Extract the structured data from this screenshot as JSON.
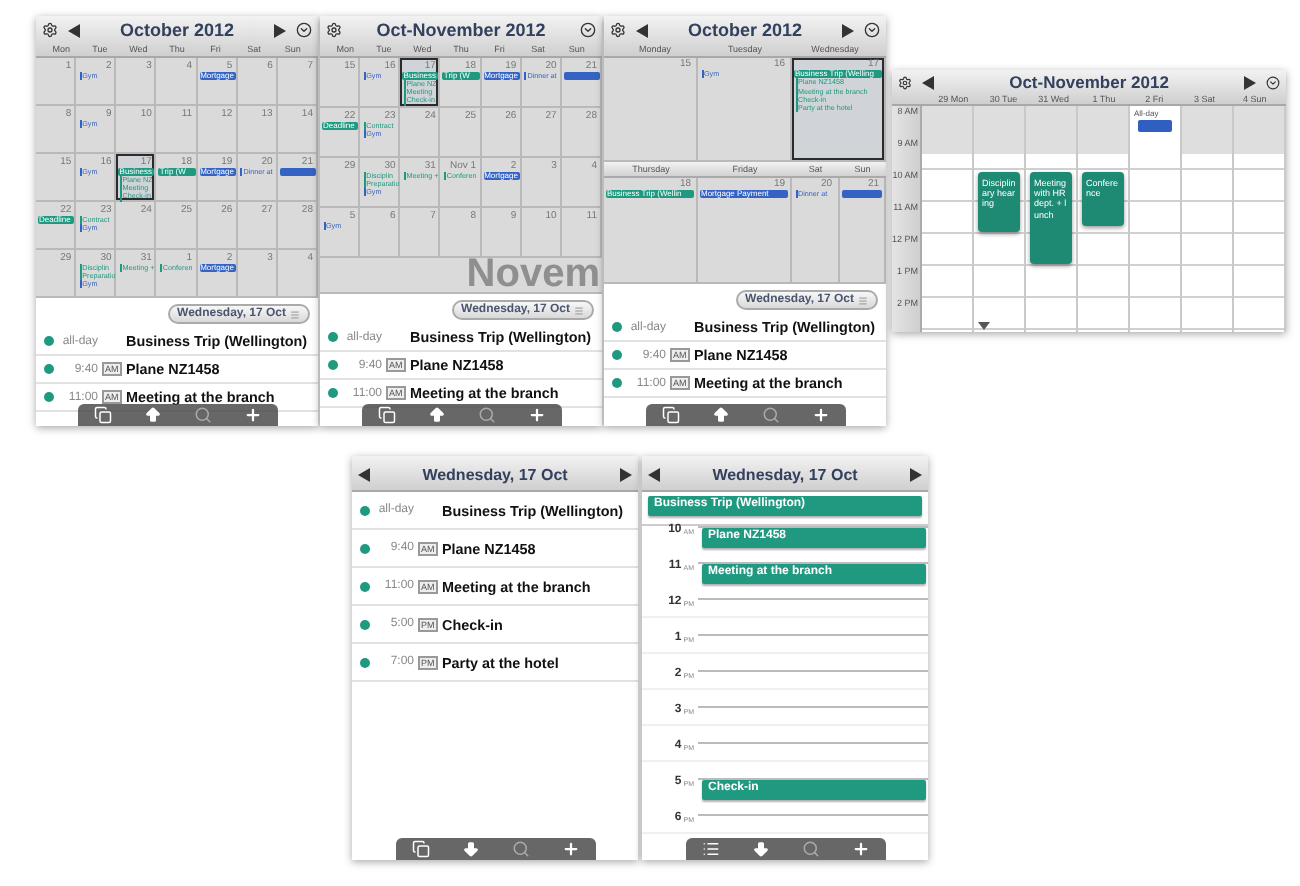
{
  "screens": [
    {
      "kind": "month",
      "title": "October 2012",
      "arrows": true,
      "weekdays": [
        "Mon",
        "Tue",
        "Wed",
        "Thu",
        "Fri",
        "Sat",
        "Sun"
      ],
      "weeks": [
        {
          "days": [
            {
              "day": "1",
              "selected": false
            },
            {
              "day": "2",
              "selected": false,
              "events": [
                {
                  "kind": "text",
                  "text": "Gym",
                  "color": "#3563c4"
                }
              ]
            },
            {
              "day": "3",
              "selected": false
            },
            {
              "day": "4",
              "selected": false
            },
            {
              "day": "5",
              "selected": false,
              "events": [
                {
                  "kind": "chip",
                  "text": "Mortgage",
                  "color": "#3563c4"
                }
              ]
            },
            {
              "day": "6",
              "selected": false
            },
            {
              "day": "7",
              "selected": false
            }
          ]
        },
        {
          "days": [
            {
              "day": "8",
              "selected": false
            },
            {
              "day": "9",
              "selected": false,
              "events": [
                {
                  "kind": "text",
                  "text": "Gym",
                  "color": "#3563c4"
                }
              ]
            },
            {
              "day": "10",
              "selected": false
            },
            {
              "day": "11",
              "selected": false
            },
            {
              "day": "12",
              "selected": false
            },
            {
              "day": "13",
              "selected": false
            },
            {
              "day": "14",
              "selected": false
            }
          ]
        },
        {
          "days": [
            {
              "day": "15",
              "selected": false
            },
            {
              "day": "16",
              "selected": false,
              "events": [
                {
                  "kind": "text",
                  "text": "Gym",
                  "color": "#3563c4"
                }
              ]
            },
            {
              "day": "17",
              "selected": true,
              "events": [
                {
                  "kind": "chip",
                  "text": "Business",
                  "color": "#1f9a80"
                },
                {
                  "kind": "text",
                  "text": "Plane NZ",
                  "color": "#1f9a80"
                },
                {
                  "kind": "text",
                  "text": "Meeting",
                  "color": "#1f9a80"
                },
                {
                  "kind": "text",
                  "text": "Check-in",
                  "color": "#1f9a80"
                }
              ]
            },
            {
              "day": "18",
              "selected": false,
              "events": [
                {
                  "kind": "chip",
                  "text": "Trip (W",
                  "color": "#1f9a80"
                }
              ]
            },
            {
              "day": "19",
              "selected": false,
              "events": [
                {
                  "kind": "chip",
                  "text": "Mortgage",
                  "color": "#3563c4"
                }
              ]
            },
            {
              "day": "20",
              "selected": false,
              "events": [
                {
                  "kind": "text",
                  "text": "Dinner at",
                  "color": "#3563c4"
                }
              ]
            },
            {
              "day": "21",
              "selected": false,
              "events": [
                {
                  "kind": "chip",
                  "color": "#3563c4"
                }
              ]
            }
          ]
        },
        {
          "days": [
            {
              "day": "22",
              "selected": false,
              "events": [
                {
                  "kind": "chip",
                  "text": "Deadline",
                  "color": "#1f9a80"
                }
              ]
            },
            {
              "day": "23",
              "selected": false,
              "events": [
                {
                  "kind": "text",
                  "text": "Contract",
                  "color": "#1f9a80"
                },
                {
                  "kind": "text",
                  "text": "Gym",
                  "color": "#3563c4"
                }
              ]
            },
            {
              "day": "24",
              "selected": false
            },
            {
              "day": "25",
              "selected": false
            },
            {
              "day": "26",
              "selected": false
            },
            {
              "day": "27",
              "selected": false
            },
            {
              "day": "28",
              "selected": false
            }
          ]
        },
        {
          "days": [
            {
              "day": "29",
              "selected": false
            },
            {
              "day": "30",
              "selected": false,
              "events": [
                {
                  "kind": "text",
                  "text": "Disciplin",
                  "color": "#1f9a80"
                },
                {
                  "kind": "text",
                  "text": "Preparatio",
                  "color": "#1f9a80"
                },
                {
                  "kind": "text",
                  "text": "Gym",
                  "color": "#3563c4"
                }
              ]
            },
            {
              "day": "31",
              "selected": false,
              "events": [
                {
                  "kind": "text",
                  "text": "Meeting +",
                  "color": "#1f9a80"
                }
              ]
            },
            {
              "day": "1",
              "selected": false,
              "events": [
                {
                  "kind": "text",
                  "text": "Conferen",
                  "color": "#1f9a80"
                }
              ]
            },
            {
              "day": "2",
              "selected": false,
              "events": [
                {
                  "kind": "chip",
                  "text": "Mortgage",
                  "color": "#3563c4"
                }
              ]
            },
            {
              "day": "3",
              "selected": false
            },
            {
              "day": "4",
              "selected": false
            }
          ]
        }
      ],
      "day_pill": "Wednesday, 17 Oct",
      "agenda": [
        {
          "time": "all-day",
          "title": "Business Trip (Wellington)",
          "color": "#1f9a80"
        },
        {
          "time": "9:40",
          "badge": "AM",
          "title": "Plane NZ1458",
          "color": "#1f9a80"
        },
        {
          "time": "11:00",
          "badge": "AM",
          "title": "Meeting at the branch",
          "color": "#1f9a80"
        }
      ],
      "toolbar": [
        {
          "kind": "pages"
        },
        {
          "kind": "up"
        },
        {
          "kind": "search"
        },
        {
          "kind": "add"
        }
      ]
    },
    {
      "kind": "month",
      "title": "Oct-November 2012",
      "arrows": false,
      "weekdays": [
        "Mon",
        "Tue",
        "Wed",
        "Thu",
        "Fri",
        "Sat",
        "Sun"
      ],
      "overlay": "Novem",
      "weeks": [
        {
          "days": [
            {
              "day": "15",
              "selected": false
            },
            {
              "day": "16",
              "selected": false,
              "events": [
                {
                  "kind": "text",
                  "text": "Gym",
                  "color": "#3563c4"
                }
              ]
            },
            {
              "day": "17",
              "selected": true,
              "events": [
                {
                  "kind": "chip",
                  "text": "Business",
                  "color": "#1f9a80"
                },
                {
                  "kind": "text",
                  "text": "Plane NZ",
                  "color": "#1f9a80"
                },
                {
                  "kind": "text",
                  "text": "Meeting",
                  "color": "#1f9a80"
                },
                {
                  "kind": "text",
                  "text": "Check-in",
                  "color": "#1f9a80"
                }
              ]
            },
            {
              "day": "18",
              "selected": false,
              "events": [
                {
                  "kind": "chip",
                  "text": "Trip (W",
                  "color": "#1f9a80"
                }
              ]
            },
            {
              "day": "19",
              "selected": false,
              "events": [
                {
                  "kind": "chip",
                  "text": "Mortgage",
                  "color": "#3563c4"
                }
              ]
            },
            {
              "day": "20",
              "selected": false,
              "events": [
                {
                  "kind": "text",
                  "text": "Dinner at",
                  "color": "#3563c4"
                }
              ]
            },
            {
              "day": "21",
              "selected": false,
              "events": [
                {
                  "kind": "chip",
                  "color": "#3563c4"
                }
              ]
            }
          ]
        },
        {
          "days": [
            {
              "day": "22",
              "selected": false,
              "events": [
                {
                  "kind": "chip",
                  "text": "Deadline",
                  "color": "#1f9a80"
                }
              ]
            },
            {
              "day": "23",
              "selected": false,
              "events": [
                {
                  "kind": "text",
                  "text": "Contract",
                  "color": "#1f9a80"
                },
                {
                  "kind": "text",
                  "text": "Gym",
                  "color": "#3563c4"
                }
              ]
            },
            {
              "day": "24",
              "selected": false
            },
            {
              "day": "25",
              "selected": false
            },
            {
              "day": "26",
              "selected": false
            },
            {
              "day": "27",
              "selected": false
            },
            {
              "day": "28",
              "selected": false
            }
          ]
        },
        {
          "days": [
            {
              "day": "29",
              "selected": false
            },
            {
              "day": "30",
              "selected": false,
              "events": [
                {
                  "kind": "text",
                  "text": "Disciplin",
                  "color": "#1f9a80"
                },
                {
                  "kind": "text",
                  "text": "Preparatio",
                  "color": "#1f9a80"
                },
                {
                  "kind": "text",
                  "text": "Gym",
                  "color": "#3563c4"
                }
              ]
            },
            {
              "day": "31",
              "selected": false,
              "events": [
                {
                  "kind": "text",
                  "text": "Meeting +",
                  "color": "#1f9a80"
                }
              ]
            },
            {
              "day": "Nov 1",
              "selected": false,
              "events": [
                {
                  "kind": "text",
                  "text": "Conferen",
                  "color": "#1f9a80"
                }
              ]
            },
            {
              "day": "2",
              "selected": false,
              "events": [
                {
                  "kind": "chip",
                  "text": "Mortgage",
                  "color": "#3563c4"
                }
              ]
            },
            {
              "day": "3",
              "selected": false
            },
            {
              "day": "4",
              "selected": false
            }
          ]
        },
        {
          "days": [
            {
              "day": "5",
              "selected": false,
              "events": [
                {
                  "kind": "text",
                  "text": "Gym",
                  "color": "#3563c4"
                }
              ]
            },
            {
              "day": "6",
              "selected": false
            },
            {
              "day": "7",
              "selected": false
            },
            {
              "day": "8",
              "selected": false
            },
            {
              "day": "9",
              "selected": false
            },
            {
              "day": "10",
              "selected": false
            },
            {
              "day": "11",
              "selected": false
            }
          ]
        }
      ],
      "day_pill": "Wednesday, 17 Oct",
      "agenda": [
        {
          "time": "all-day",
          "title": "Business Trip (Wellington)",
          "color": "#1f9a80"
        },
        {
          "time": "9:40",
          "badge": "AM",
          "title": "Plane NZ1458",
          "color": "#1f9a80"
        },
        {
          "time": "11:00",
          "badge": "AM",
          "title": "Meeting at the branch",
          "color": "#1f9a80"
        }
      ],
      "toolbar": [
        {
          "kind": "pages"
        },
        {
          "kind": "up"
        },
        {
          "kind": "search"
        },
        {
          "kind": "add"
        }
      ]
    },
    {
      "kind": "week_split",
      "title": "October 2012",
      "arrows": true,
      "top": [
        {
          "label": "Monday",
          "day": "15",
          "selected": false
        },
        {
          "label": "Tuesday",
          "day": "16",
          "selected": false,
          "events": [
            {
              "kind": "text",
              "text": "Gym",
              "color": "#3563c4"
            }
          ]
        },
        {
          "label": "Wednesday",
          "day": "17",
          "selected": true,
          "events": [
            {
              "kind": "chip",
              "text": "Business Trip (Welling",
              "color": "#1f9a80"
            },
            {
              "kind": "text",
              "text": "Plane NZ1458",
              "color": "#1f9a80"
            },
            {
              "kind": "text",
              "text": "Meeting at the branch",
              "color": "#1f9a80"
            },
            {
              "kind": "text",
              "text": "Check-in",
              "color": "#1f9a80"
            },
            {
              "kind": "text",
              "text": "Party at the hotel",
              "color": "#1f9a80"
            }
          ]
        }
      ],
      "bottom": [
        {
          "label": "Thursday",
          "day": "18",
          "selected": false,
          "events": [
            {
              "kind": "chip",
              "text": "Business Trip (Wellin",
              "color": "#1f9a80"
            }
          ]
        },
        {
          "label": "Friday",
          "day": "19",
          "selected": false,
          "events": [
            {
              "kind": "chip",
              "text": "Mortgage Payment",
              "color": "#3563c4"
            }
          ]
        },
        {
          "label": "Sat",
          "day": "20",
          "selected": false,
          "events": [
            {
              "kind": "text",
              "text": "Dinner at",
              "color": "#3563c4"
            }
          ]
        },
        {
          "label": "Sun",
          "day": "21",
          "selected": false,
          "events": [
            {
              "kind": "chip",
              "color": "#3563c4"
            }
          ]
        }
      ],
      "day_pill": "Wednesday, 17 Oct",
      "agenda": [
        {
          "time": "all-day",
          "title": "Business Trip (Wellington)",
          "color": "#1f9a80"
        },
        {
          "time": "9:40",
          "badge": "AM",
          "title": "Plane NZ1458",
          "color": "#1f9a80"
        },
        {
          "time": "11:00",
          "badge": "AM",
          "title": "Meeting at the branch",
          "color": "#1f9a80"
        }
      ],
      "toolbar": [
        {
          "kind": "pages"
        },
        {
          "kind": "up"
        },
        {
          "kind": "search"
        },
        {
          "kind": "add"
        }
      ]
    },
    {
      "kind": "week_grid",
      "title": "Oct-November 2012",
      "arrows": true,
      "hours": [
        {
          "hour": "8",
          "suffix": "AM"
        },
        {
          "hour": "9",
          "suffix": "AM"
        },
        {
          "hour": "10",
          "suffix": "AM"
        },
        {
          "hour": "11",
          "suffix": "AM"
        },
        {
          "hour": "12",
          "suffix": "PM"
        },
        {
          "hour": "1",
          "suffix": "PM"
        },
        {
          "hour": "2",
          "suffix": "PM"
        }
      ],
      "days": [
        {
          "label": "29 Mon"
        },
        {
          "label": "30 Tue",
          "events": [
            {
              "text": "Disciplinary hearing",
              "color": "#1f8a74"
            }
          ]
        },
        {
          "label": "31 Wed",
          "events": [
            {
              "text": "Meeting with HR dept. + lunch",
              "color": "#1f8a74"
            }
          ]
        },
        {
          "label": "1 Thu",
          "events": [
            {
              "text": "Conference",
              "color": "#1f8a74"
            }
          ]
        },
        {
          "label": "2 Fri",
          "allday_label": "All-day",
          "allday": [
            {
              "color": "#2f5fc0"
            }
          ]
        },
        {
          "label": "3 Sat"
        },
        {
          "label": "4 Sun"
        }
      ]
    },
    {
      "kind": "day_list",
      "title": "Wednesday, 17 Oct",
      "arrows": true,
      "agenda": [
        {
          "time": "all-day",
          "title": "Business Trip (Wellington)",
          "color": "#1f9a80"
        },
        {
          "time": "9:40",
          "badge": "AM",
          "title": "Plane NZ1458",
          "color": "#1f9a80"
        },
        {
          "time": "11:00",
          "badge": "AM",
          "title": "Meeting at the branch",
          "color": "#1f9a80"
        },
        {
          "time": "5:00",
          "badge": "PM",
          "title": "Check-in",
          "color": "#1f9a80"
        },
        {
          "time": "7:00",
          "badge": "PM",
          "title": "Party at the hotel",
          "color": "#1f9a80"
        }
      ],
      "toolbar": [
        {
          "kind": "pages"
        },
        {
          "kind": "down"
        },
        {
          "kind": "search"
        },
        {
          "kind": "add"
        }
      ]
    },
    {
      "kind": "day_timeline",
      "title": "Wednesday, 17 Oct",
      "arrows": true,
      "allday": [
        {
          "text": "Business Trip (Wellington)",
          "color": "#1f9a80"
        }
      ],
      "hours": [
        {
          "hour": "10",
          "suffix": "AM",
          "events": [
            {
              "text": "Plane NZ1458",
              "color": "#1f9a80"
            }
          ]
        },
        {
          "hour": "11",
          "suffix": "AM",
          "events": [
            {
              "text": "Meeting at the branch",
              "color": "#1f9a80"
            }
          ]
        },
        {
          "hour": "12",
          "suffix": "PM"
        },
        {
          "hour": "1",
          "suffix": "PM"
        },
        {
          "hour": "2",
          "suffix": "PM"
        },
        {
          "hour": "3",
          "suffix": "PM"
        },
        {
          "hour": "4",
          "suffix": "PM"
        },
        {
          "hour": "5",
          "suffix": "PM",
          "events": [
            {
              "text": "Check-in",
              "color": "#1f9a80"
            }
          ]
        },
        {
          "hour": "6",
          "suffix": "PM"
        }
      ],
      "toolbar": [
        {
          "kind": "list"
        },
        {
          "kind": "down"
        },
        {
          "kind": "search"
        },
        {
          "kind": "add"
        }
      ]
    }
  ]
}
